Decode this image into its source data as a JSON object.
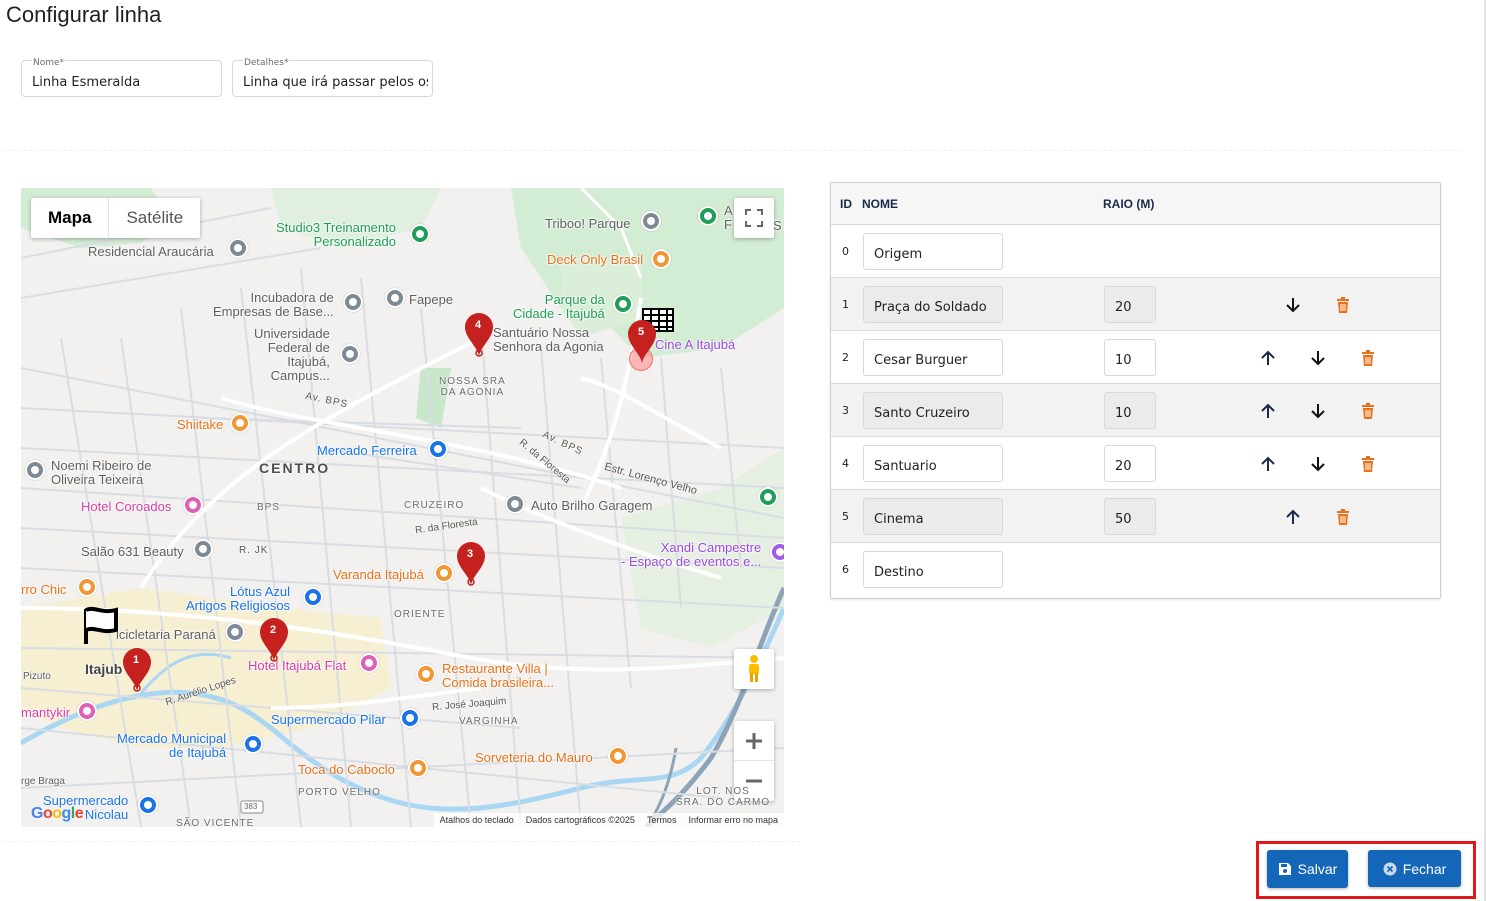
{
  "page": {
    "title": "Configurar linha"
  },
  "form": {
    "nome_label": "Nome*",
    "nome_value": "Linha Esmeralda",
    "detalhes_label": "Detalhes*",
    "detalhes_value": "Linha que irá passar pelos os"
  },
  "map": {
    "type_active": "Mapa",
    "type_inactive": "Satélite",
    "labels": {
      "studio3": "Studio3 Treinamento\nPersonalizado",
      "triboo": "Triboo! Parque",
      "deck": "Deck Only Brasil",
      "residencial": "Residencial Araucária",
      "incubadora": "Incubadora de\nEmpresas de Base...",
      "fapepe": "Fapepe",
      "universidade": "Universidade\nFederal de\nItajubá,\nCampus...",
      "parque": "Parque da\nCidade - Itajubá",
      "santuario": "Santuário Nossa\nSenhora da Agonia",
      "cine": "Cine A Itajubá",
      "shiitake": "Shiitake",
      "mercado_ferreira": "Mercado Ferreira",
      "noemi": "Noemi Ribeiro de\nOliveira Teixeira",
      "hotel_coroados": "Hotel Coroados",
      "auto_brilho": "Auto Brilho Garagem",
      "salao": "Salão 631 Beauty",
      "xandi": "Xandi Campestre\n- Espaço de eventos e...",
      "varanda": "Varanda Itajubá",
      "lotus": "Lótus Azul\nArtigos Religiosos",
      "chic": "rro Chic",
      "bicicletaria": "icicletaria Paraná",
      "hotel_flat": "Hotel Itajubá Flat",
      "restaurante_villa": "Restaurante Villa |\nComida brasileira...",
      "itajuba": "Itajub",
      "pizuto": "Pizuto",
      "mantykir": "mantykir",
      "supermercado_pilar": "Supermercado Pilar",
      "mercado_municipal": "Mercado Municipal\nde Itajubá",
      "sorveteria": "Sorveteria do Mauro",
      "toca": "Toca do Caboclo",
      "supermercado_nicolau": "Supermercado\nNicolau",
      "braga": "rge Braga",
      "a_f": "A\nF",
      "s": "S"
    },
    "districts": {
      "centro": "CENTRO",
      "nossa_sra": "NOSSA SRA\nDA AGONIA",
      "bps": "BPS",
      "cruzeiro": "CRUZEIRO",
      "oriente": "ORIENTE",
      "varginha": "VARGINHA",
      "porto_velho": "PORTO VELHO",
      "lot_nossa": "LOT. NOS\nSRA. DO CARMO",
      "sao_vicente": "SÃO VICENTE"
    },
    "streets": {
      "av_bps": "Av. BPS",
      "r_floresta1": "R. da Floresta",
      "r_floresta2": "R. da Floresta",
      "r_jk": "R. JK",
      "estr_lorenco": "Estr. Lorenço Velho",
      "av_bps2": "Av. BPS",
      "r_aurelio": "R. Aurélio Lopes",
      "r_jose": "R. José Joaquim",
      "road_383": "383"
    },
    "markers": [
      {
        "number": "1"
      },
      {
        "number": "2"
      },
      {
        "number": "3"
      },
      {
        "number": "4"
      },
      {
        "number": "5"
      }
    ],
    "google_logo": "Google",
    "attribution": {
      "keyboard": "Atalhos do teclado",
      "data": "Dados cartográficos ©2025",
      "terms": "Termos",
      "report": "Informar erro no mapa"
    }
  },
  "table": {
    "headers": {
      "id": "ID",
      "nome": "NOME",
      "raio": "RAIO (M)"
    },
    "rows": [
      {
        "id": "0",
        "nome": "Origem",
        "raio": ""
      },
      {
        "id": "1",
        "nome": "Praça do Soldado",
        "raio": "20"
      },
      {
        "id": "2",
        "nome": "Cesar Burguer",
        "raio": "10"
      },
      {
        "id": "3",
        "nome": "Santo Cruzeiro",
        "raio": "10"
      },
      {
        "id": "4",
        "nome": "Santuario",
        "raio": "20"
      },
      {
        "id": "5",
        "nome": "Cinema",
        "raio": "50"
      },
      {
        "id": "6",
        "nome": "Destino",
        "raio": ""
      }
    ]
  },
  "actions": {
    "save_label": "Salvar",
    "close_label": "Fechar"
  },
  "colors": {
    "primary_button": "#1466b8",
    "highlight_box": "#e01818",
    "trash": "#e8711a",
    "marker": "#c5221f"
  }
}
